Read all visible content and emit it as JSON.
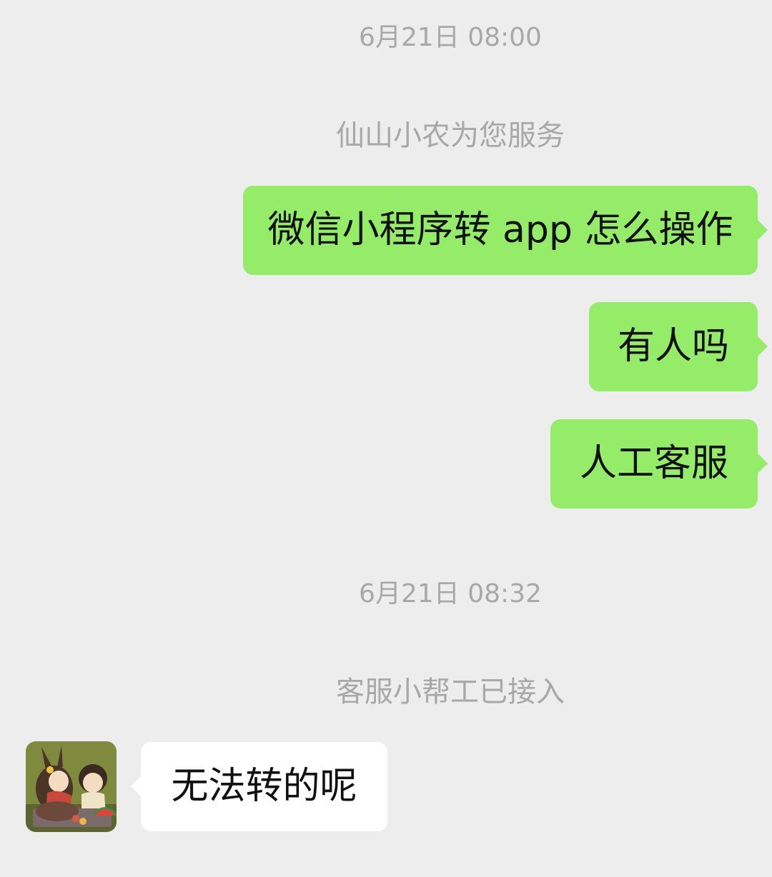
{
  "chat": {
    "messages": [
      {
        "type": "timestamp",
        "text": "6月21日 08:00"
      },
      {
        "type": "system",
        "text": "仙山小农为您服务"
      },
      {
        "type": "outgoing",
        "text": "微信小程序转 app 怎么操作"
      },
      {
        "type": "outgoing",
        "text": "有人吗"
      },
      {
        "type": "outgoing",
        "text": "人工客服"
      },
      {
        "type": "timestamp",
        "text": "6月21日 08:32"
      },
      {
        "type": "system",
        "text": "客服小帮工已接入"
      },
      {
        "type": "incoming",
        "text": "无法转的呢",
        "avatar": "game-character-avatar-icon"
      }
    ]
  },
  "colors": {
    "background": "#ededed",
    "outgoing_bubble": "#95ec69",
    "incoming_bubble": "#ffffff",
    "meta_text": "#a8a8a8",
    "message_text": "#111111"
  }
}
